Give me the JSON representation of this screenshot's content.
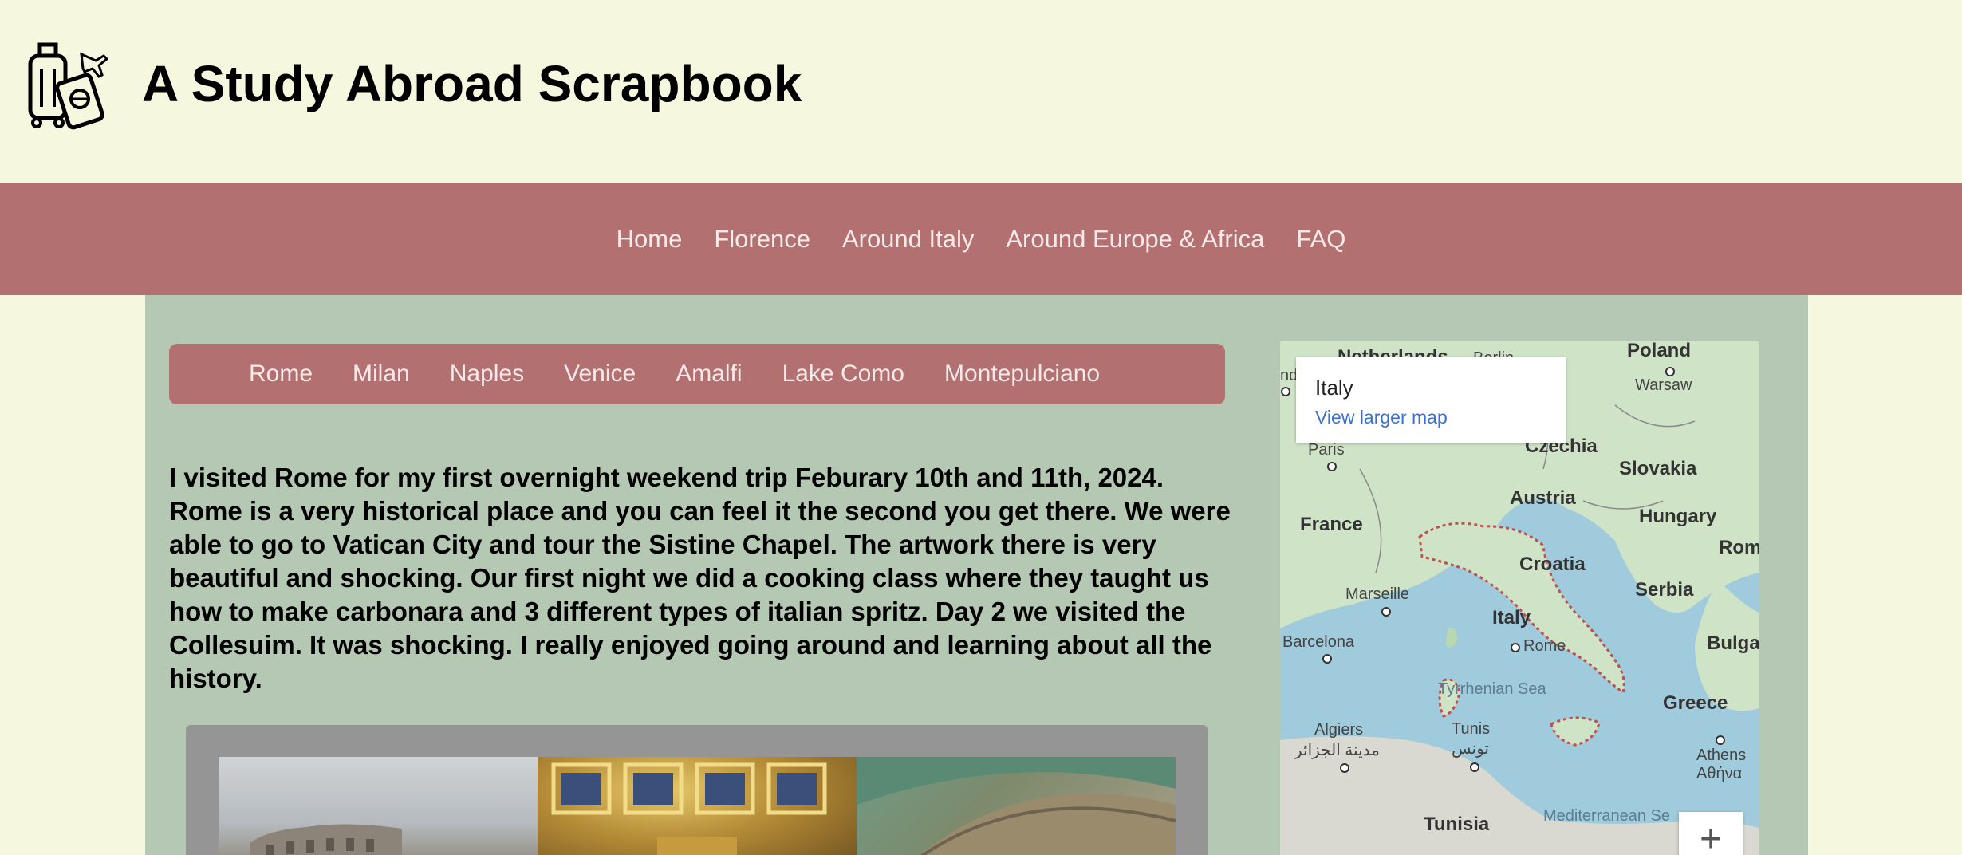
{
  "site": {
    "title": "A Study Abroad Scrapbook",
    "logo_icon": "luggage-passport-icon"
  },
  "main_nav": {
    "items": [
      "Home",
      "Florence",
      "Around Italy",
      "Around Europe & Africa",
      "FAQ"
    ]
  },
  "sub_nav": {
    "items": [
      "Rome",
      "Milan",
      "Naples",
      "Venice",
      "Amalfi",
      "Lake Como",
      "Montepulciano"
    ]
  },
  "story": {
    "text": "I visited Rome for my first overnight weekend trip Feburary 10th and 11th, 2024. Rome is a very historical place and you can feel it the second you get there. We were able to go to Vatican City and tour the Sistine Chapel. The artwork there is very beautiful and shocking. Our first night we did a cooking class where they taught us how to make carbonara and 3 different types of italian spritz. Day 2 we visited the Collesuim. It was shocking. I really enjoyed going around and learning about all the history."
  },
  "map": {
    "card_title": "Italy",
    "card_link": "View larger map",
    "zoom_in": "+",
    "labels": {
      "netherlands": "Netherlands",
      "poland": "Poland",
      "warsaw": "Warsaw",
      "paris": "Paris",
      "czechia": "Czechia",
      "slovakia": "Slovakia",
      "austria": "Austria",
      "hungary": "Hungary",
      "france": "France",
      "romania": "Roman",
      "croatia": "Croatia",
      "serbia": "Serbia",
      "marseille": "Marseille",
      "italy": "Italy",
      "barcelona": "Barcelona",
      "rome": "Rome",
      "bulgaria": "Bulga",
      "tyrrhenian": "Tyrrhenian Sea",
      "greece": "Greece",
      "algiers": "Algiers",
      "algiers_ar": "مدينة الجزائر",
      "tunis": "Tunis",
      "tunis_ar": "تونس",
      "athens": "Athens",
      "athens_gr": "Αθήνα",
      "tunisia": "Tunisia",
      "mediterranean": "Mediterranean Se",
      "edge_nd": "nd",
      "berlin": "Berlin"
    }
  },
  "colors": {
    "background": "#f5f8df",
    "nav": "#b37070",
    "content": "#b5c8b3",
    "gallery": "#959595"
  }
}
